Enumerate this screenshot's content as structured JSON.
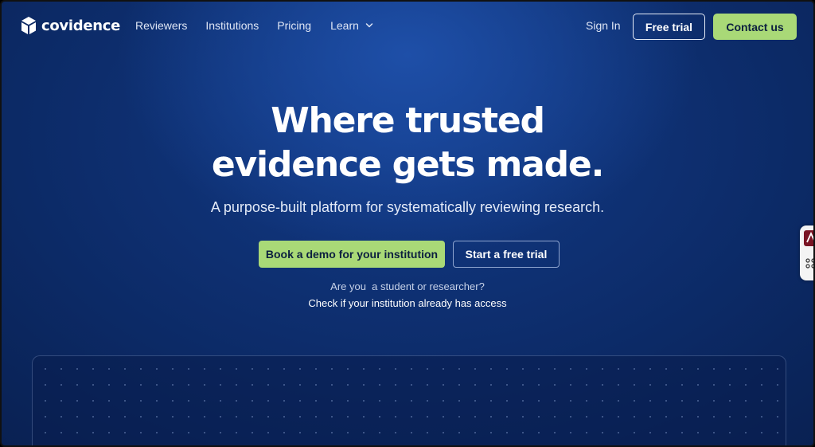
{
  "brand": {
    "name": "covidence",
    "logo_icon": "cube-logo-icon"
  },
  "nav": {
    "links": [
      {
        "label": "Reviewers"
      },
      {
        "label": "Institutions"
      },
      {
        "label": "Pricing"
      },
      {
        "label": "Learn",
        "icon": "chevron-down-icon"
      }
    ],
    "sign_in": "Sign In",
    "free_trial": "Free trial",
    "contact": "Contact us"
  },
  "hero": {
    "title_line1": "Where trusted",
    "title_line2": "evidence gets made.",
    "subtitle": "A purpose-built platform for systematically reviewing research.",
    "primary_cta": "Book a demo for your institution",
    "secondary_cta": "Start a free trial",
    "question": "Are you  a student or researcher?",
    "check_link": "Check if your institution already has access"
  },
  "colors": {
    "accent_green": "#a9d977",
    "background_navy": "#0c2a66",
    "text_dark": "#0c1f3f"
  },
  "side_widget": {
    "icon": "pdf-extension-icon",
    "menu_icon": "dots-icon"
  }
}
